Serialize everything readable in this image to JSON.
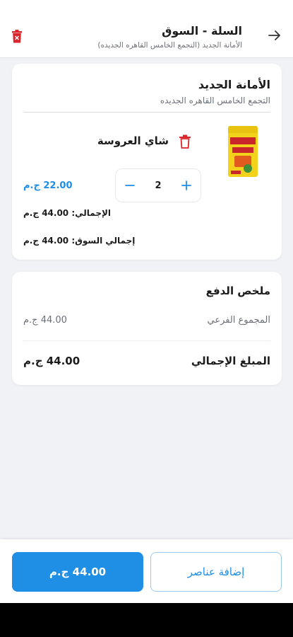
{
  "header": {
    "title": "السلة - السوق",
    "subtitle": "الأمانة الجديد (التجمع الخامس القاهره الجديده)"
  },
  "store": {
    "name": "الأمانة الجديد",
    "address": "التجمع الخامس القاهره الجديده",
    "item": {
      "name": "شاي العروسة",
      "quantity": "2",
      "unit_price": "22.00 ج.م",
      "line_total": "الإجمالي: 44.00 ج.م"
    },
    "market_total": "إجمالي السوق: 44.00 ج.م"
  },
  "payment": {
    "title": "ملخص الدفع",
    "subtotal_label": "المجموع الفرعي",
    "subtotal_value": "44.00 ج.م",
    "total_label": "المبلغ الإجمالي",
    "total_value": "44.00 ج.م"
  },
  "bottom": {
    "pay_button": "44.00 ج.م",
    "add_items_button": "إضافة عناصر"
  },
  "icons": {
    "back": "arrow-right-icon",
    "clear": "trash-icon",
    "delete_item": "trash-outline-icon",
    "plus": "plus-icon",
    "minus": "minus-icon"
  },
  "colors": {
    "accent": "#1f8fe6",
    "danger": "#d9252c",
    "background": "#f1f2f5"
  }
}
